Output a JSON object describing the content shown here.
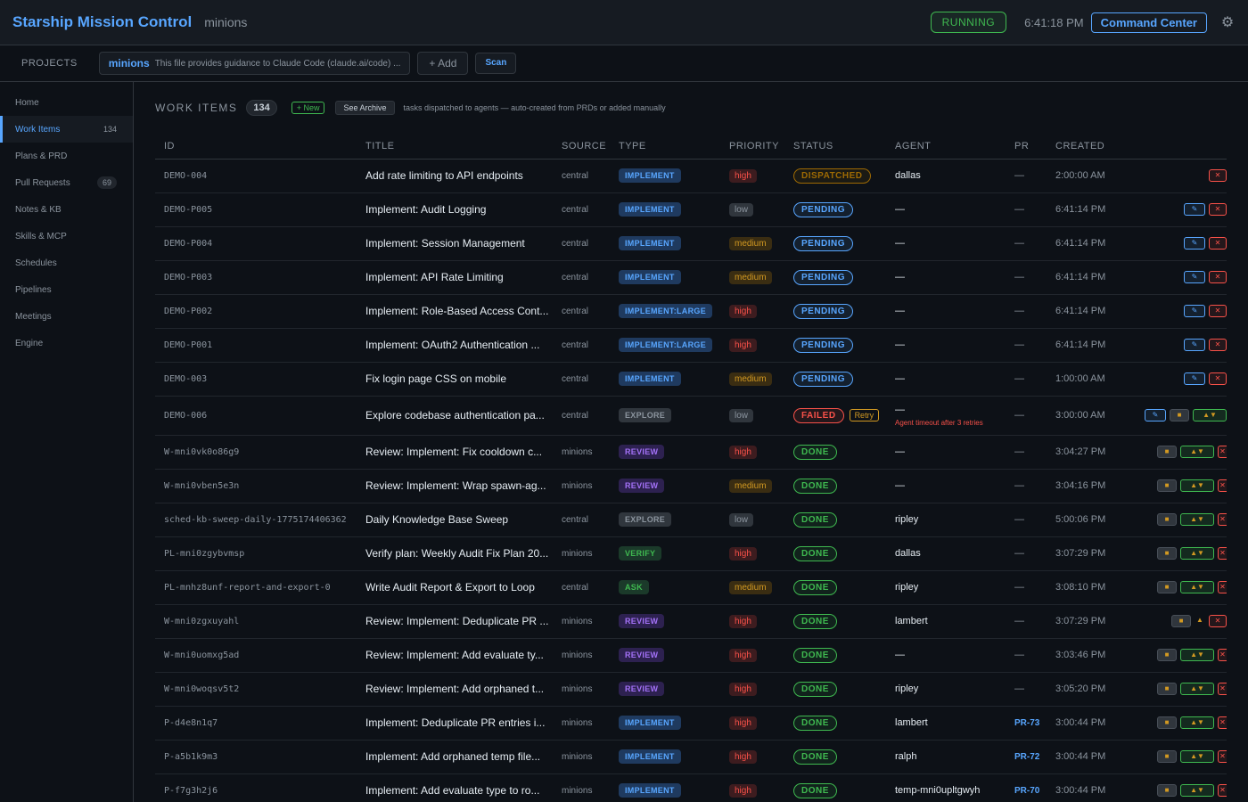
{
  "header": {
    "title": "Starship Mission Control",
    "subtitle": "minions",
    "status": "RUNNING",
    "clock": "6:41:18 PM",
    "command_center": "Command Center"
  },
  "projects": {
    "label": "PROJECTS",
    "current_name": "minions",
    "current_desc": "This file provides guidance to Claude Code (claude.ai/code) ...",
    "add_label": "+ Add",
    "scan_label": "Scan"
  },
  "sidebar": {
    "items": [
      {
        "label": "Home",
        "count": ""
      },
      {
        "label": "Work Items",
        "count": "134"
      },
      {
        "label": "Plans & PRD",
        "count": ""
      },
      {
        "label": "Pull Requests",
        "count": "69"
      },
      {
        "label": "Notes & KB",
        "count": ""
      },
      {
        "label": "Skills & MCP",
        "count": ""
      },
      {
        "label": "Schedules",
        "count": ""
      },
      {
        "label": "Pipelines",
        "count": ""
      },
      {
        "label": "Meetings",
        "count": ""
      },
      {
        "label": "Engine",
        "count": ""
      }
    ]
  },
  "work_items": {
    "title": "WORK ITEMS",
    "count": "134",
    "new_label": "+ New",
    "archive_label": "See Archive",
    "description": "tasks dispatched to agents — auto-created from PRDs or added manually",
    "columns": [
      "ID",
      "TITLE",
      "SOURCE",
      "TYPE",
      "PRIORITY",
      "STATUS",
      "AGENT",
      "PR",
      "CREATED"
    ],
    "retry_label": "Retry",
    "rows": [
      {
        "id": "DEMO-004",
        "title": "Add rate limiting to API endpoints",
        "source": "central",
        "type": "IMPLEMENT",
        "priority": "high",
        "status": "DISPATCHED",
        "agent": "dallas",
        "pr": "—",
        "created": "2:00:00 AM",
        "actions": "del"
      },
      {
        "id": "DEMO-P005",
        "title": "Implement: Audit Logging",
        "source": "central",
        "type": "IMPLEMENT",
        "priority": "low",
        "status": "PENDING",
        "agent": "—",
        "pr": "—",
        "created": "6:41:14 PM",
        "actions": "edit-del"
      },
      {
        "id": "DEMO-P004",
        "title": "Implement: Session Management",
        "source": "central",
        "type": "IMPLEMENT",
        "priority": "medium",
        "status": "PENDING",
        "agent": "—",
        "pr": "—",
        "created": "6:41:14 PM",
        "actions": "edit-del"
      },
      {
        "id": "DEMO-P003",
        "title": "Implement: API Rate Limiting",
        "source": "central",
        "type": "IMPLEMENT",
        "priority": "medium",
        "status": "PENDING",
        "agent": "—",
        "pr": "—",
        "created": "6:41:14 PM",
        "actions": "edit-del"
      },
      {
        "id": "DEMO-P002",
        "title": "Implement: Role-Based Access Cont...",
        "source": "central",
        "type": "IMPLEMENT:LARGE",
        "priority": "high",
        "status": "PENDING",
        "agent": "—",
        "pr": "—",
        "created": "6:41:14 PM",
        "actions": "edit-del"
      },
      {
        "id": "DEMO-P001",
        "title": "Implement: OAuth2 Authentication ...",
        "source": "central",
        "type": "IMPLEMENT:LARGE",
        "priority": "high",
        "status": "PENDING",
        "agent": "—",
        "pr": "—",
        "created": "6:41:14 PM",
        "actions": "edit-del"
      },
      {
        "id": "DEMO-003",
        "title": "Fix login page CSS on mobile",
        "source": "central",
        "type": "IMPLEMENT",
        "priority": "medium",
        "status": "PENDING",
        "agent": "—",
        "pr": "—",
        "created": "1:00:00 AM",
        "actions": "edit-del"
      },
      {
        "id": "DEMO-006",
        "title": "Explore codebase authentication pa...",
        "source": "central",
        "type": "EXPLORE",
        "priority": "low",
        "status": "FAILED",
        "agent": "—",
        "error": "Agent timeout after 3 retries",
        "pr": "—",
        "created": "3:00:00 AM",
        "actions": "edit-box-thumbs"
      },
      {
        "id": "W-mni0vk0o86g9",
        "title": "Review: Implement: Fix cooldown c...",
        "source": "minions",
        "type": "REVIEW",
        "priority": "high",
        "status": "DONE",
        "agent": "—",
        "pr": "—",
        "created": "3:04:27 PM",
        "actions": "box-thumbs-cut"
      },
      {
        "id": "W-mni0vben5e3n",
        "title": "Review: Implement: Wrap spawn-ag...",
        "source": "minions",
        "type": "REVIEW",
        "priority": "medium",
        "status": "DONE",
        "agent": "—",
        "pr": "—",
        "created": "3:04:16 PM",
        "actions": "box-thumbs-cut"
      },
      {
        "id": "sched-kb-sweep-daily-1775174406362",
        "title": "Daily Knowledge Base Sweep",
        "source": "central",
        "type": "EXPLORE",
        "priority": "low",
        "status": "DONE",
        "agent": "ripley",
        "pr": "—",
        "created": "5:00:06 PM",
        "actions": "box-thumbs-cut"
      },
      {
        "id": "PL-mni0zgybvmsp",
        "title": "Verify plan: Weekly Audit Fix Plan 20...",
        "source": "minions",
        "type": "VERIFY",
        "priority": "high",
        "status": "DONE",
        "agent": "dallas",
        "pr": "—",
        "created": "3:07:29 PM",
        "actions": "box-thumbs-cut"
      },
      {
        "id": "PL-mnhz8unf-report-and-export-0",
        "title": "Write Audit Report & Export to Loop",
        "source": "central",
        "type": "ASK",
        "priority": "medium",
        "status": "DONE",
        "agent": "ripley",
        "pr": "—",
        "created": "3:08:10 PM",
        "actions": "box-thumbs-cut"
      },
      {
        "id": "W-mni0zgxuyahl",
        "title": "Review: Implement: Deduplicate PR ...",
        "source": "minions",
        "type": "REVIEW",
        "priority": "high",
        "status": "DONE",
        "agent": "lambert",
        "pr": "—",
        "created": "3:07:29 PM",
        "actions": "box-thumb-del"
      },
      {
        "id": "W-mni0uomxg5ad",
        "title": "Review: Implement: Add evaluate ty...",
        "source": "minions",
        "type": "REVIEW",
        "priority": "high",
        "status": "DONE",
        "agent": "—",
        "pr": "—",
        "created": "3:03:46 PM",
        "actions": "box-thumbs-cut"
      },
      {
        "id": "W-mni0woqsv5t2",
        "title": "Review: Implement: Add orphaned t...",
        "source": "minions",
        "type": "REVIEW",
        "priority": "high",
        "status": "DONE",
        "agent": "ripley",
        "pr": "—",
        "created": "3:05:20 PM",
        "actions": "box-thumbs-cut"
      },
      {
        "id": "P-d4e8n1q7",
        "title": "Implement: Deduplicate PR entries i...",
        "source": "minions",
        "type": "IMPLEMENT",
        "priority": "high",
        "status": "DONE",
        "agent": "lambert",
        "pr": "PR-73",
        "created": "3:00:44 PM",
        "actions": "box-thumbs-cut"
      },
      {
        "id": "P-a5b1k9m3",
        "title": "Implement: Add orphaned temp file...",
        "source": "minions",
        "type": "IMPLEMENT",
        "priority": "high",
        "status": "DONE",
        "agent": "ralph",
        "pr": "PR-72",
        "created": "3:00:44 PM",
        "actions": "box-thumbs-cut"
      },
      {
        "id": "P-f7g3h2j6",
        "title": "Implement: Add evaluate type to ro...",
        "source": "minions",
        "type": "IMPLEMENT",
        "priority": "high",
        "status": "DONE",
        "agent": "temp-mni0upltgwyh",
        "pr": "PR-70",
        "created": "3:00:44 PM",
        "actions": "box-thumbs-cut"
      }
    ]
  },
  "colors": {
    "accent": "#58a6ff",
    "success": "#3fb950",
    "danger": "#f85149",
    "warning": "#d29922",
    "background": "#0d1117"
  },
  "icons": {
    "settings": "gear-icon",
    "edit": "pencil-icon",
    "delete": "close-icon",
    "archive": "box-icon",
    "feedback": "thumbs-icon"
  }
}
